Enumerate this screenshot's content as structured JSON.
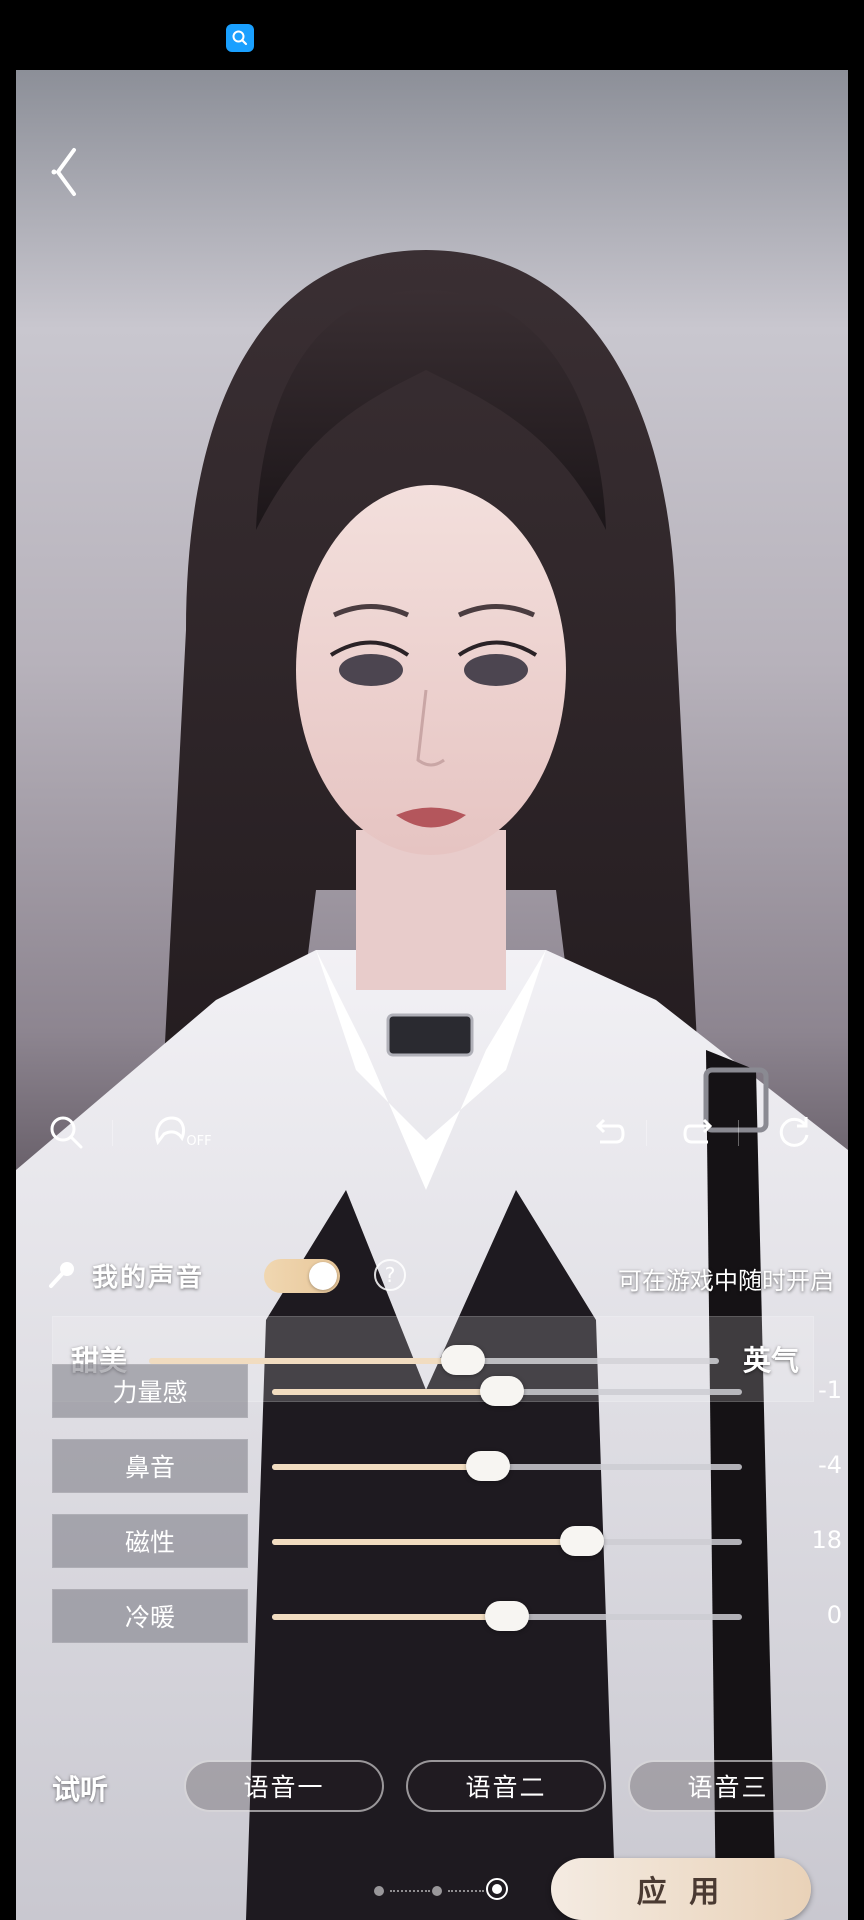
{
  "status_bar": {
    "icon": "search-icon",
    "icon_color": "#1aa0ff"
  },
  "toolbar": {
    "left_icons": [
      "search-icon",
      "hair-off-icon"
    ],
    "hair_toggle_text": "OFF",
    "right_icons": [
      "undo-icon",
      "redo-icon",
      "reset-icon"
    ]
  },
  "voice": {
    "title": "我的声音",
    "enabled": true,
    "hint": "可在游戏中随时开启"
  },
  "main_slider": {
    "left_label": "甜美",
    "right_label": "英气",
    "level": 0.55
  },
  "params": [
    {
      "label": "力量感",
      "value": "-1",
      "level": 0.49
    },
    {
      "label": "鼻音",
      "value": "-4",
      "level": 0.46
    },
    {
      "label": "磁性",
      "value": "18",
      "level": 0.66
    },
    {
      "label": "冷暖",
      "value": "0",
      "level": 0.5
    }
  ],
  "listen": {
    "label": "试听",
    "buttons": [
      "语音一",
      "语音二",
      "语音三"
    ]
  },
  "pagination": {
    "pages": 3,
    "current": 3
  },
  "apply_label": "应 用",
  "colors": {
    "accent": "#f1dcc0",
    "toggle_on": "#e8c79a",
    "button_text": "#4a3a32"
  }
}
